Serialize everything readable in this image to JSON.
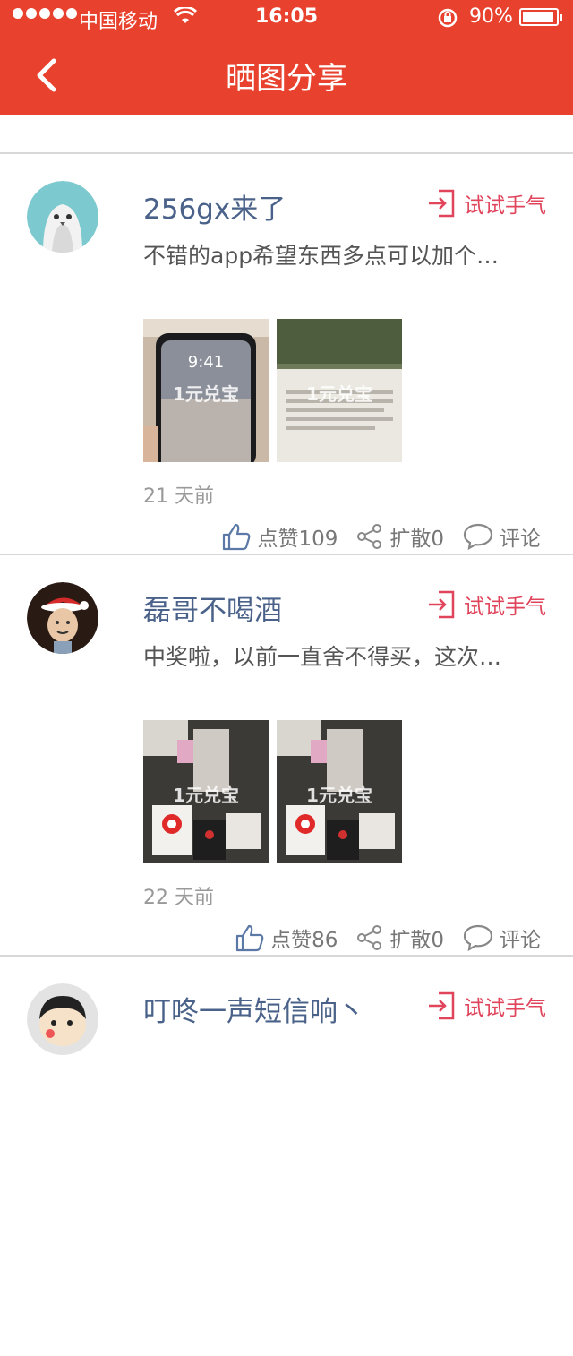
{
  "status": {
    "carrier": "中国移动",
    "time": "16:05",
    "battery": "90%",
    "battery_level": 0.9
  },
  "nav": {
    "title": "晒图分享"
  },
  "posts": [
    {
      "username": "256gx来了",
      "try_label": "试试手气",
      "content": "不错的app希望东西多点可以加个…",
      "watermark": "1元兑宝",
      "time_ago": "21 天前",
      "like_label": "点赞109",
      "share_label": "扩散0",
      "comment_label": "评论"
    },
    {
      "username": "磊哥不喝酒",
      "try_label": "试试手气",
      "content": "中奖啦，以前一直舍不得买，这次…",
      "watermark": "1元兑宝",
      "time_ago": "22 天前",
      "like_label": "点赞86",
      "share_label": "扩散0",
      "comment_label": "评论"
    },
    {
      "username": "叮咚一声短信响丶",
      "try_label": "试试手气"
    }
  ]
}
